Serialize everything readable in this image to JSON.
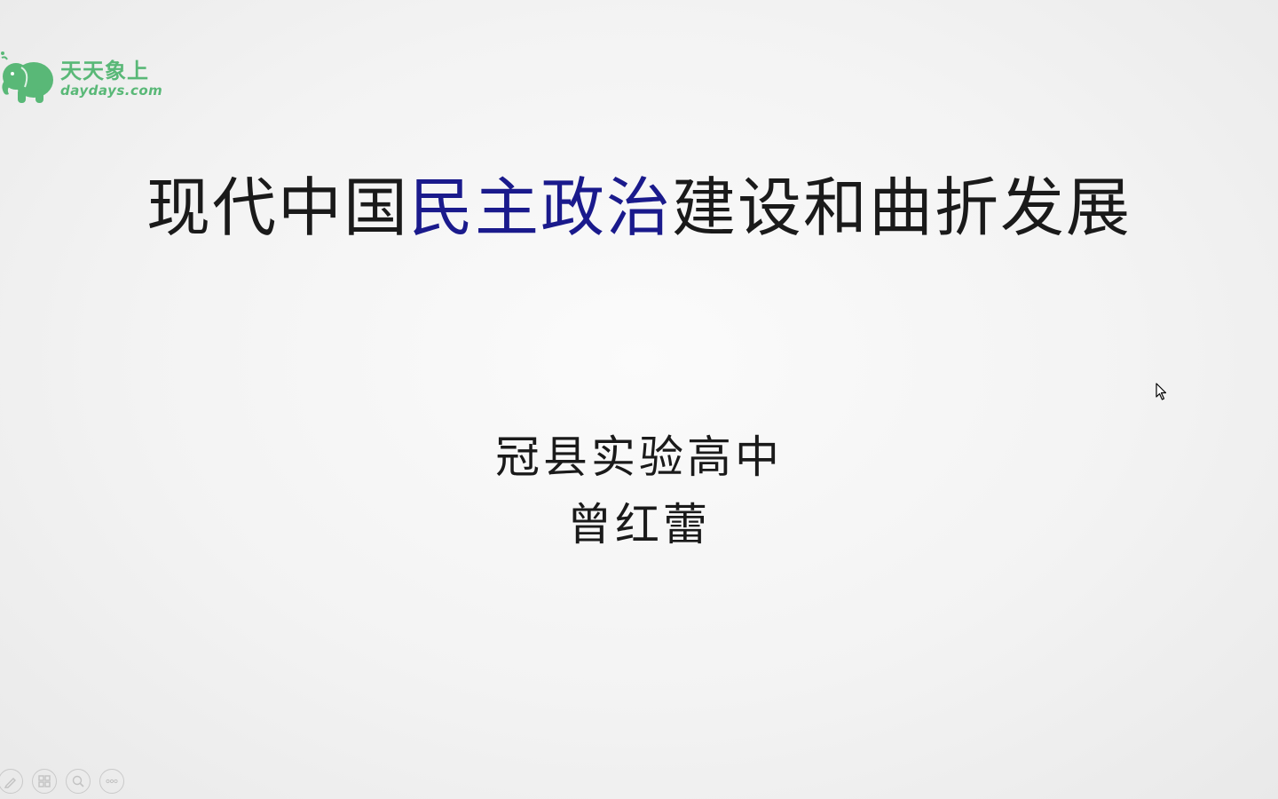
{
  "logo": {
    "brand_cn": "天天象上",
    "brand_en": "daydays.com",
    "icon": "elephant-icon",
    "color": "#59b877"
  },
  "slide": {
    "title_part1": "现代中国",
    "title_highlight": "民主政治",
    "title_part2": "建设和曲折发展",
    "school": "冠县实验高中",
    "author": "曾红蕾",
    "text_color": "#1a1a1a",
    "highlight_color": "#1a1a8c"
  },
  "toolbar": {
    "items": [
      {
        "name": "pen-icon"
      },
      {
        "name": "slides-grid-icon"
      },
      {
        "name": "zoom-icon"
      },
      {
        "name": "more-options-icon"
      }
    ]
  },
  "cursor": {
    "icon": "mouse-pointer-icon"
  }
}
